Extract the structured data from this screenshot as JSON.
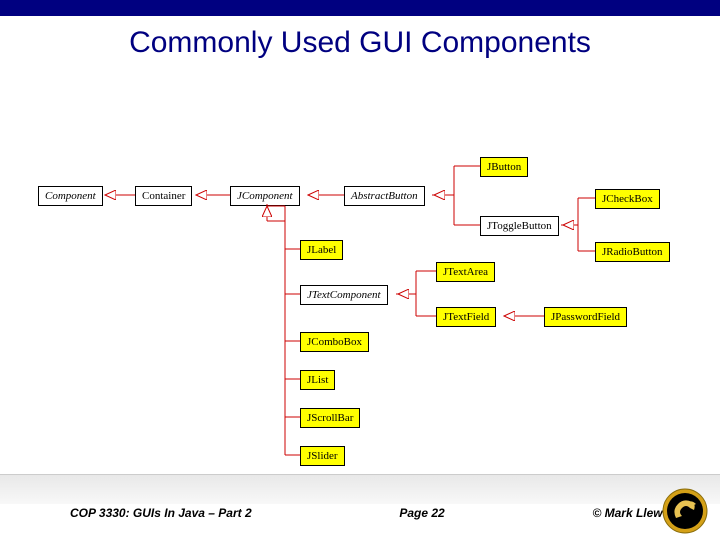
{
  "title": "Commonly Used GUI Components",
  "nodes": {
    "component": "Component",
    "container": "Container",
    "jcomponent": "JComponent",
    "abstractbutton": "AbstractButton",
    "jbutton": "JButton",
    "jtogglebutton": "JToggleButton",
    "jcheckbox": "JCheckBox",
    "jradiobutton": "JRadioButton",
    "jlabel": "JLabel",
    "jtextcomponent": "JTextComponent",
    "jtextarea": "JTextArea",
    "jtextfield": "JTextField",
    "jpasswordfield": "JPasswordField",
    "jcombobox": "JComboBox",
    "jlist": "JList",
    "jscrollbar": "JScrollBar",
    "jslider": "JSlider"
  },
  "footer": {
    "left": "COP 3330:  GUIs In Java – Part 2",
    "page": "Page 22",
    "right": "© Mark Llewellyn"
  }
}
